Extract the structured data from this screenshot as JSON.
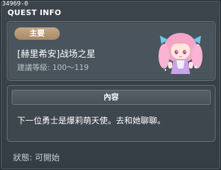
{
  "quest_window": {
    "quest_id": "34969-0",
    "title": "QUEST INFO",
    "category": "主要",
    "quest_name": "[赫里希安]战场之星",
    "recommended_level": "建議等級: 100～119",
    "npc_icon": "pink-haired-girl-npc-portrait",
    "content_header": "內容",
    "content_text": "下一位勇士是爆莉萌天使。去和她聊聊。",
    "status": "狀態:  可開始"
  },
  "colors": {
    "window_bg": "#3a434a",
    "panel_border": "#68737c",
    "badge": "#b8997a",
    "text": "#ffffff",
    "subtext": "#b9c3ca"
  }
}
